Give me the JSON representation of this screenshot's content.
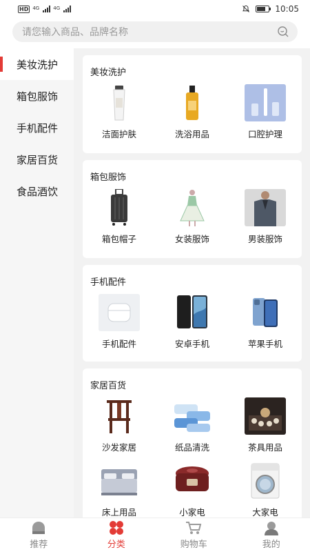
{
  "status_bar": {
    "hd_label": "HD",
    "signal_tag_1": "4G",
    "signal_tag_2": "4G",
    "time": "10:05"
  },
  "search": {
    "placeholder": "请您输入商品、品牌名称"
  },
  "sidebar": {
    "items": [
      {
        "label": "美妆洗护",
        "active": true
      },
      {
        "label": "箱包服饰"
      },
      {
        "label": "手机配件"
      },
      {
        "label": "家居百货"
      },
      {
        "label": "食品酒饮"
      }
    ]
  },
  "sections": [
    {
      "title": "美妆洗护",
      "items": [
        {
          "label": "洁面护肤",
          "icon": "face-cream-icon"
        },
        {
          "label": "洗浴用品",
          "icon": "body-oil-icon"
        },
        {
          "label": "口腔护理",
          "icon": "electric-toothbrush-icon"
        }
      ]
    },
    {
      "title": "箱包服饰",
      "items": [
        {
          "label": "箱包帽子",
          "icon": "suitcase-icon"
        },
        {
          "label": "女装服饰",
          "icon": "dress-icon"
        },
        {
          "label": "男装服饰",
          "icon": "mens-jacket-icon"
        }
      ]
    },
    {
      "title": "手机配件",
      "items": [
        {
          "label": "手机配件",
          "icon": "earbuds-case-icon"
        },
        {
          "label": "安卓手机",
          "icon": "android-phone-icon"
        },
        {
          "label": "苹果手机",
          "icon": "iphone-icon"
        }
      ]
    },
    {
      "title": "家居百货",
      "items": [
        {
          "label": "沙发家居",
          "icon": "wooden-chair-icon"
        },
        {
          "label": "纸品清洗",
          "icon": "tissue-pack-icon"
        },
        {
          "label": "茶具用品",
          "icon": "tea-set-icon"
        },
        {
          "label": "床上用品",
          "icon": "bed-icon"
        },
        {
          "label": "小家电",
          "icon": "rice-cooker-icon"
        },
        {
          "label": "大家电",
          "icon": "washing-machine-icon"
        }
      ]
    }
  ],
  "tabbar": {
    "items": [
      {
        "label": "推荐",
        "icon": "home-icon"
      },
      {
        "label": "分类",
        "icon": "category-icon",
        "active": true
      },
      {
        "label": "购物车",
        "icon": "cart-icon"
      },
      {
        "label": "我的",
        "icon": "profile-icon"
      }
    ]
  },
  "colors": {
    "accent": "#e33b36",
    "background": "#f2f2f2",
    "card": "#ffffff",
    "sidebar": "#f6f6f6"
  }
}
